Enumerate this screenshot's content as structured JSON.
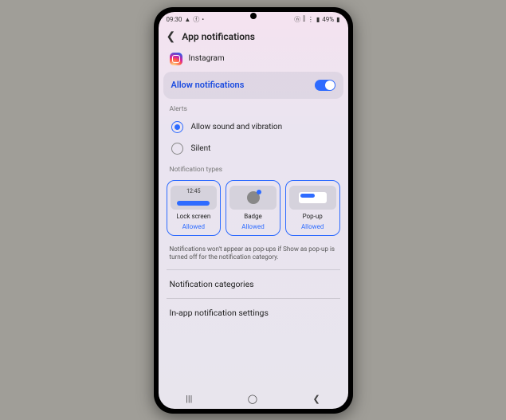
{
  "status_bar": {
    "time": "09:30",
    "battery": "49%"
  },
  "header": {
    "title": "App notifications"
  },
  "app": {
    "name": "Instagram"
  },
  "allow": {
    "label": "Allow notifications",
    "state": true
  },
  "alerts": {
    "section_label": "Alerts",
    "options": [
      {
        "label": "Allow sound and vibration",
        "selected": true
      },
      {
        "label": "Silent",
        "selected": false
      }
    ]
  },
  "types": {
    "section_label": "Notification types",
    "cards": [
      {
        "label": "Lock screen",
        "status": "Allowed",
        "preview_time": "12:45"
      },
      {
        "label": "Badge",
        "status": "Allowed"
      },
      {
        "label": "Pop-up",
        "status": "Allowed"
      }
    ]
  },
  "footnote": "Notifications won't appear as pop-ups if Show as pop-up is turned off for the notification category.",
  "links": {
    "categories": "Notification categories",
    "in_app": "In-app notification settings"
  }
}
